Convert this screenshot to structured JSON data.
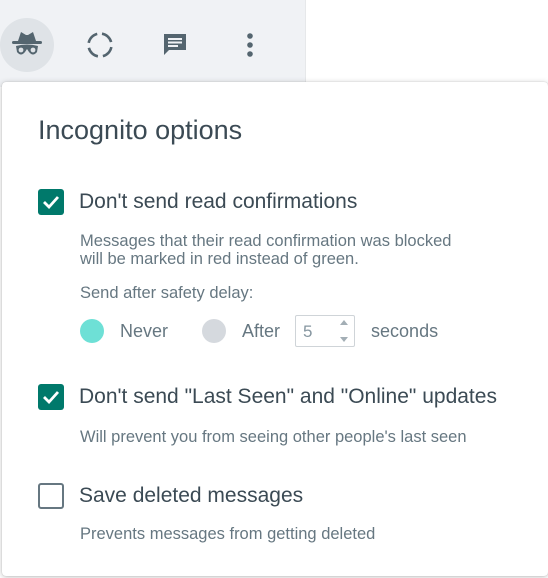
{
  "toolbar": {
    "buttons": [
      {
        "icon": "incognito-icon",
        "active": true
      },
      {
        "icon": "status-icon",
        "active": false
      },
      {
        "icon": "chat-icon",
        "active": false
      },
      {
        "icon": "menu-dots-icon",
        "active": false
      }
    ]
  },
  "colors": {
    "accent": "#00796b",
    "radio_selected": "#6ee0d6",
    "radio_unselected": "#d5d9de",
    "text_primary": "#3b4a54",
    "text_secondary": "#667781"
  },
  "panel": {
    "title": "Incognito options",
    "options": [
      {
        "label": "Don't send read confirmations",
        "checked": true,
        "description_lines": [
          "Messages that their read confirmation was blocked",
          "will be marked in red instead of green."
        ],
        "delay": {
          "label": "Send after safety delay:",
          "never_label": "Never",
          "after_label": "After",
          "selected": "never",
          "value": "5",
          "unit_label": "seconds"
        }
      },
      {
        "label": "Don't send \"Last Seen\" and \"Online\" updates",
        "checked": true,
        "description": "Will prevent you from seeing other people's last seen"
      },
      {
        "label": "Save deleted messages",
        "checked": false,
        "description": "Prevents messages from getting deleted"
      }
    ]
  }
}
